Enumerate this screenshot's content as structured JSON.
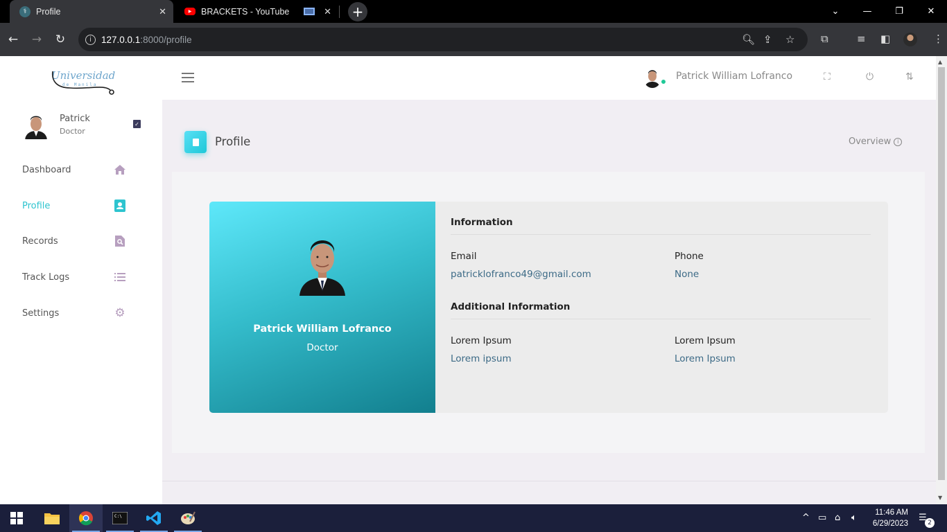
{
  "browser": {
    "tabs": [
      {
        "title": "Profile"
      },
      {
        "title": "BRACKETS - YouTube"
      }
    ],
    "url_host": "127.0.0.1",
    "url_rest": ":8000/profile"
  },
  "sidebar": {
    "logo_text": "Universidad",
    "logo_subtext": "de Manila",
    "user": {
      "name": "Patrick",
      "role": "Doctor"
    },
    "items": [
      {
        "label": "Dashboard",
        "icon": "home-icon"
      },
      {
        "label": "Profile",
        "icon": "contact-card-icon"
      },
      {
        "label": "Records",
        "icon": "search-file-icon"
      },
      {
        "label": "Track Logs",
        "icon": "list-icon"
      },
      {
        "label": "Settings",
        "icon": "gear-icon"
      }
    ],
    "active_item": "Profile"
  },
  "header": {
    "user_name": "Patrick William Lofranco"
  },
  "page": {
    "title": "Profile",
    "overview_label": "Overview"
  },
  "profile": {
    "name": "Patrick William Lofranco",
    "role": "Doctor",
    "information_heading": "Information",
    "email_label": "Email",
    "email_value": "patricklofranco49@gmail.com",
    "phone_label": "Phone",
    "phone_value": "None",
    "additional_heading": "Additional Information",
    "extra1_label": "Lorem Ipsum",
    "extra1_value": "Lorem ipsum",
    "extra2_label": "Lorem Ipsum",
    "extra2_value": "Lorem Ipsum"
  },
  "taskbar": {
    "time": "11:46 AM",
    "date": "6/29/2023",
    "notification_count": "2"
  },
  "colors": {
    "accent": "#2ec4cf",
    "card_gradient_start": "#5ee8fa",
    "card_gradient_end": "#127f8e"
  }
}
